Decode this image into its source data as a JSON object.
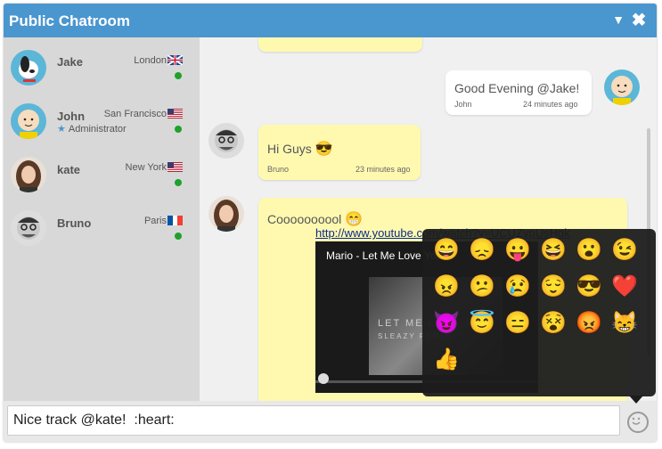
{
  "header": {
    "title": "Public Chatroom",
    "minimize_icon": "chevron-down-icon",
    "close_icon": "close-icon"
  },
  "users": [
    {
      "name": "Jake",
      "location": "London",
      "flag": "uk-flag",
      "role": ""
    },
    {
      "name": "John",
      "location": "San Francisco",
      "flag": "us-flag",
      "role": "Administrator"
    },
    {
      "name": "kate",
      "location": "New York",
      "flag": "us-flag",
      "role": ""
    },
    {
      "name": "Bruno",
      "location": "Paris",
      "flag": "fr-flag",
      "role": ""
    }
  ],
  "messages": [
    {
      "text": "Good Evening @Jake!",
      "author": "John",
      "time": "24 minutes ago",
      "side": "right"
    },
    {
      "text": "Hi Guys",
      "emoji": "😎",
      "author": "Bruno",
      "time": "23 minutes ago",
      "side": "left"
    },
    {
      "text": "Coooooooool",
      "emoji": "😁",
      "link": "http://www.youtube.com/watch?v=UCUZypUsHqk",
      "video_title": "Mario - Let Me Love You",
      "video_cover_text": "LET ME LOVE YOU",
      "video_cover_sub": "SLEAZY REMIX",
      "side": "left"
    }
  ],
  "emoji_picker": {
    "emojis": [
      "😄",
      "😞",
      "😛",
      "😆",
      "😮",
      "😉",
      "😠",
      "😕",
      "😢",
      "😌",
      "😎",
      "❤️",
      "😈",
      "😇",
      "😑",
      "😵",
      "😡",
      "😸",
      "👍"
    ]
  },
  "composer": {
    "value": "Nice track @kate!  :heart:",
    "smiley_icon": "smiley-icon"
  },
  "colors": {
    "header": "#4a96cf",
    "bubble_yellow": "#fff9b0",
    "online": "#1fa12b"
  }
}
